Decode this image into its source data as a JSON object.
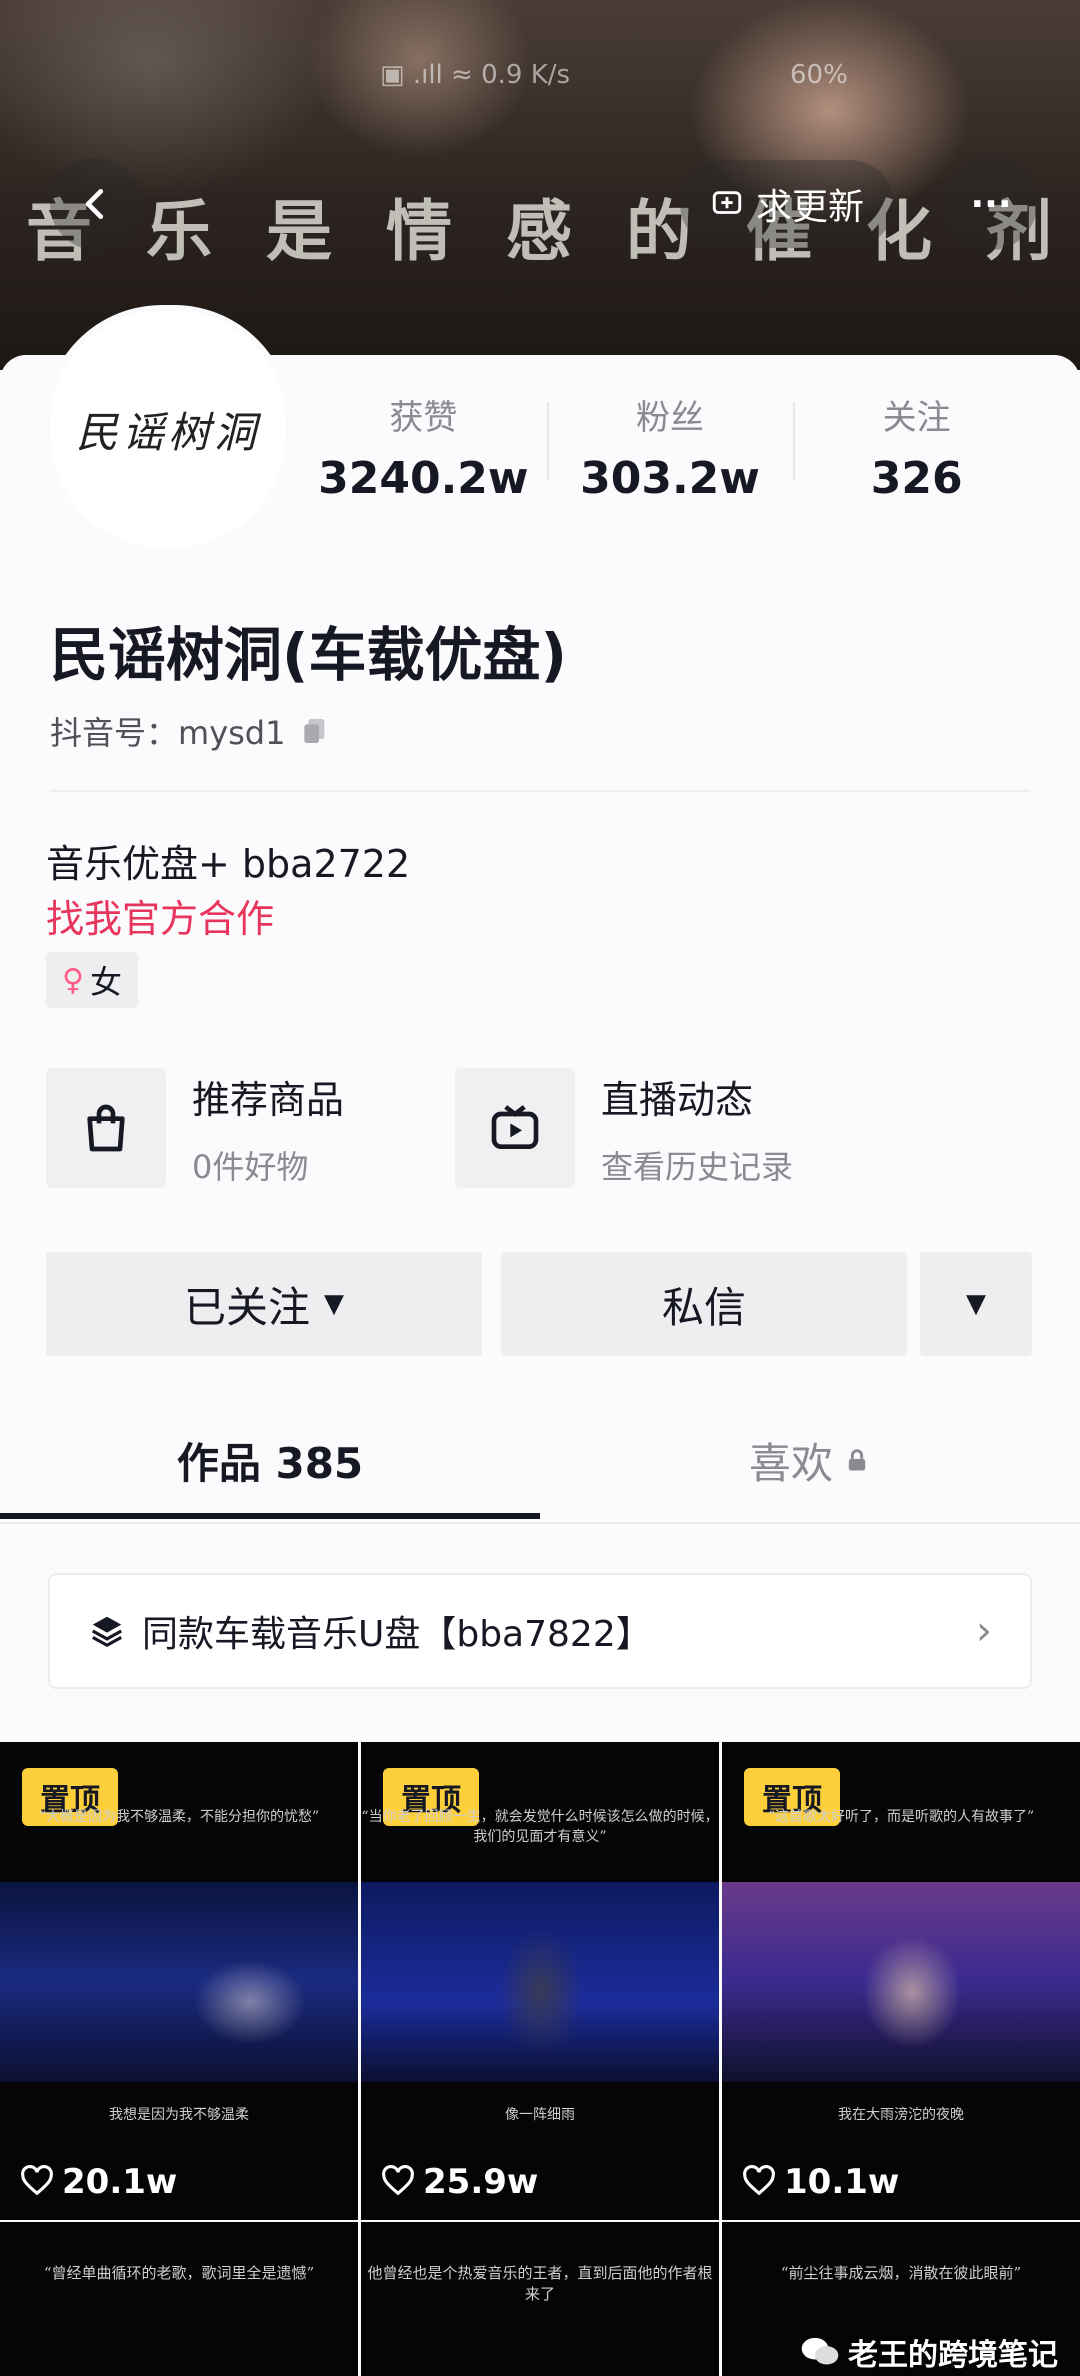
{
  "hero": {
    "banner_text": [
      "音",
      "乐",
      "是",
      "情",
      "感",
      "的",
      "催",
      "化",
      "剂"
    ],
    "update_label": "求更新"
  },
  "status_bar": {
    "left": "▣ .ıll ≈ 0.9 K/s",
    "right": "60%"
  },
  "profile": {
    "avatar_text": "民谣树洞",
    "stats": [
      {
        "label": "获赞",
        "value": "3240.2w"
      },
      {
        "label": "粉丝",
        "value": "303.2w"
      },
      {
        "label": "关注",
        "value": "326"
      }
    ],
    "name": "民谣树洞(车载优盘)",
    "id_label": "抖音号：",
    "id_value": "mysd1",
    "bio_line1": "音乐优盘+  bba2722",
    "bio_line2": "找我官方合作",
    "gender": "女",
    "gender_icon": "♀"
  },
  "features": [
    {
      "title": "推荐商品",
      "subtitle": "0件好物"
    },
    {
      "title": "直播动态",
      "subtitle": "查看历史记录"
    }
  ],
  "actions": {
    "follow_label": "已关注",
    "message_label": "私信"
  },
  "tabs": {
    "works": "作品 385",
    "likes": "喜欢"
  },
  "playlist": {
    "label": "同款车载音乐U盘【bba7822】"
  },
  "videos": [
    {
      "pin": "置顶",
      "top_caption": "“大概是因为我不够温柔，不能分担你的忧愁”",
      "bottom_caption": "我想是因为我不够温柔",
      "likes": "20.1w"
    },
    {
      "pin": "置顶",
      "top_caption": "“当你老了回顾一生，就会发觉什么时候该怎么做的时候，我们的见面才有意义”",
      "bottom_caption": "像一阵细雨",
      "likes": "25.9w"
    },
    {
      "pin": "置顶",
      "top_caption": "“这首歌太好听了，而是听歌的人有故事了”",
      "bottom_caption": "我在大雨滂沱的夜晚",
      "likes": "10.1w"
    }
  ],
  "videos_row2": [
    {
      "top_caption": "“曾经单曲循环的老歌，歌词里全是遗憾”"
    },
    {
      "top_caption": "他曾经也是个热爱音乐的王者，直到后面他的作者根来了"
    },
    {
      "top_caption": "“前尘往事成云烟，消散在彼此眼前”"
    }
  ],
  "watermark": "老王的跨境笔记",
  "colors": {
    "accent_pink": "#e8355d",
    "pin_yellow": "#fdd03b",
    "bg": "#fbfafc"
  }
}
